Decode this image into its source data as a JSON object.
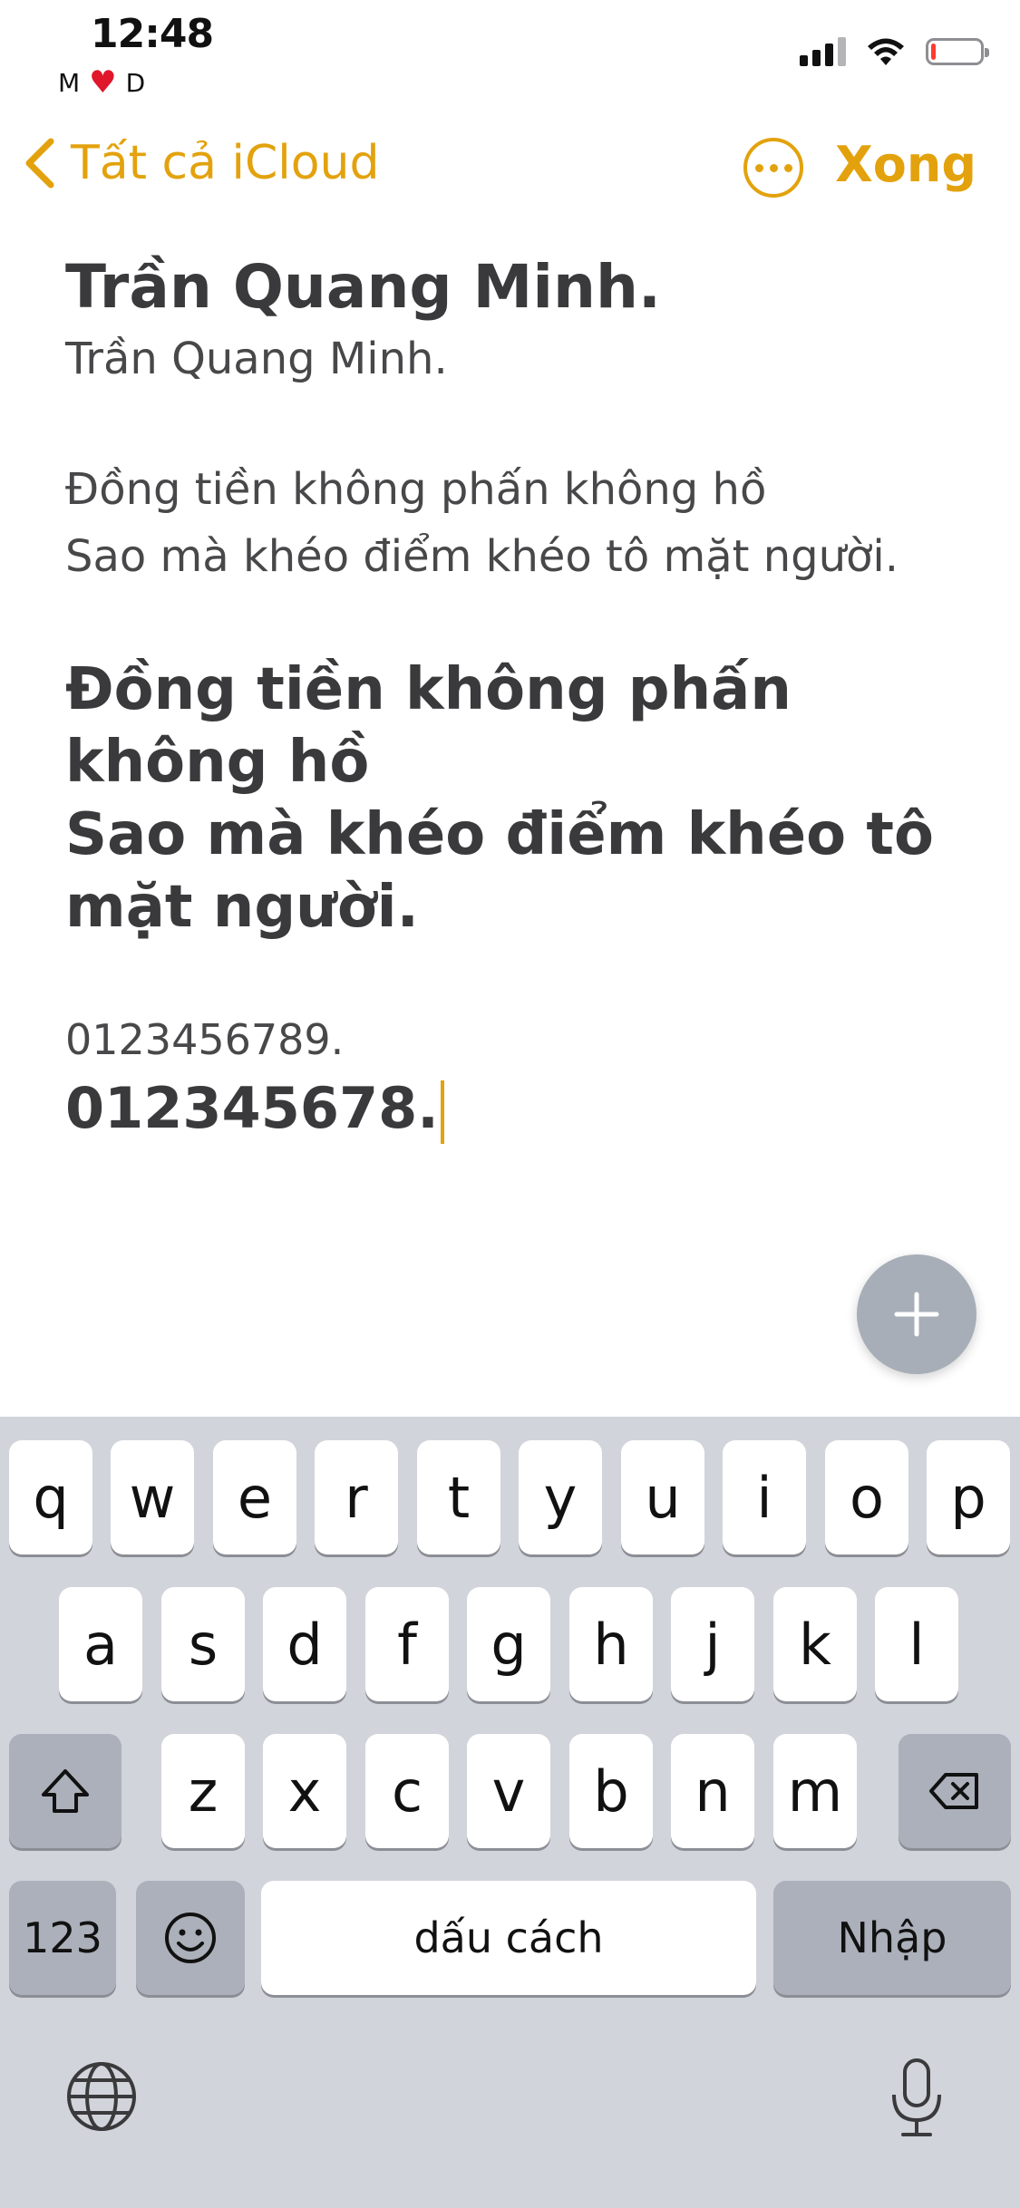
{
  "status_bar": {
    "time": "12:48",
    "carrier_left": "M",
    "carrier_heart": "♥",
    "carrier_right": "D",
    "battery_level": 0.1,
    "icons": [
      "signal-icon",
      "wifi-icon",
      "battery-icon"
    ]
  },
  "nav": {
    "back_label": "Tất cả iCloud",
    "done_label": "Xong",
    "accent_color": "#e3a20d"
  },
  "note": {
    "title": "Trần Quang Minh.",
    "subtitle": "Trần Quang Minh.",
    "poem_small_1": "Đồng tiền không phấn không hồ",
    "poem_small_2": "Sao mà khéo điểm khéo tô mặt người.",
    "poem_large_1": "Đồng tiền không phấn không hồ",
    "poem_large_2": "Sao mà khéo điểm khéo tô mặt người.",
    "numbers_small": "0123456789.",
    "numbers_large": "012345678."
  },
  "keyboard": {
    "row1": [
      "q",
      "w",
      "e",
      "r",
      "t",
      "y",
      "u",
      "i",
      "o",
      "p"
    ],
    "row2": [
      "a",
      "s",
      "d",
      "f",
      "g",
      "h",
      "j",
      "k",
      "l"
    ],
    "row3": [
      "z",
      "x",
      "c",
      "v",
      "b",
      "n",
      "m"
    ],
    "numbers_key": "123",
    "space_key": "dấu cách",
    "return_key": "Nhập"
  }
}
